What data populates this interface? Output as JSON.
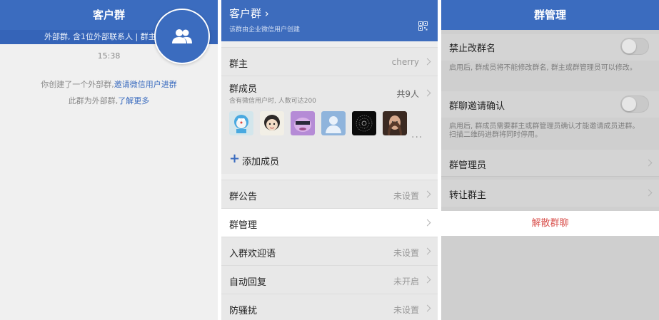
{
  "panel1": {
    "title": "客户群",
    "subtitle": "外部群, 含1位外部联系人 | 群主",
    "timestamp": "15:38",
    "msg1_text": "你创建了一个外部群,",
    "msg1_link": "邀请微信用户进群",
    "msg2_text": "此群为外部群,",
    "msg2_link": "了解更多",
    "float_icon": "group-icon"
  },
  "panel2": {
    "title": "客户群 ›",
    "subtitle": "该群由企业微信用户创建",
    "qr_icon": "qr-code-icon",
    "owner_label": "群主",
    "owner_value": "cherry",
    "members_label": "群成员",
    "members_note": "含有微信用户时, 人数可达200",
    "members_count": "共9人",
    "more": "...",
    "add_label": "添加成员",
    "rows": [
      {
        "label": "群公告",
        "value": "未设置"
      },
      {
        "label": "群管理",
        "value": ""
      },
      {
        "label": "入群欢迎语",
        "value": "未设置"
      },
      {
        "label": "自动回复",
        "value": "未开启"
      },
      {
        "label": "防骚扰",
        "value": "未设置"
      }
    ]
  },
  "panel3": {
    "title": "群管理",
    "no_rename_label": "禁止改群名",
    "no_rename_desc": "启用后, 群成员将不能修改群名, 群主或群管理员可以修改。",
    "invite_confirm_label": "群聊邀请确认",
    "invite_confirm_desc": "启用后, 群成员需要群主或群管理员确认才能邀请成员进群。扫描二维码进群将同时停用。",
    "admins_label": "群管理员",
    "transfer_label": "转让群主",
    "dissolve_label": "解散群聊"
  },
  "colors": {
    "brand": "#3b6cbf",
    "danger": "#d9534f"
  }
}
